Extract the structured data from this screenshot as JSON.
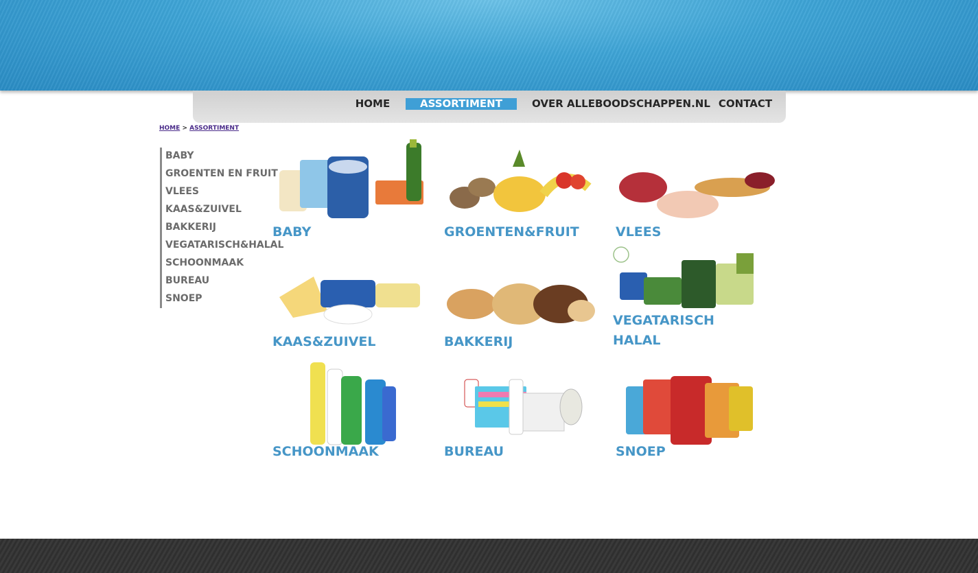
{
  "nav": {
    "home": "HOME",
    "assortiment": "ASSORTIMENT",
    "over": "OVER ALLEBOODSCHAPPEN.NL",
    "contact": "CONTACT"
  },
  "breadcrumb": {
    "home": "HOME",
    "separator": ">",
    "current": "ASSORTIMENT"
  },
  "sidebar": {
    "items": [
      {
        "label": "BABY"
      },
      {
        "label": "GROENTEN EN FRUIT"
      },
      {
        "label": "VLEES"
      },
      {
        "label": "KAAS&ZUIVEL"
      },
      {
        "label": "BAKKERIJ"
      },
      {
        "label": "VEGATARISCH&HALAL"
      },
      {
        "label": "SCHOONMAAK"
      },
      {
        "label": "BUREAU"
      },
      {
        "label": "SNOEP"
      }
    ]
  },
  "categories": {
    "baby": {
      "label": "BABY"
    },
    "groenten": {
      "label": "GROENTEN&FRUIT"
    },
    "vlees": {
      "label": "VLEES"
    },
    "kaas": {
      "label": "KAAS&ZUIVEL"
    },
    "bakkerij": {
      "label": "BAKKERIJ"
    },
    "vega_line1": {
      "label": "VEGATARISCH"
    },
    "vega_line2": {
      "label": "HALAL"
    },
    "schoonmaak": {
      "label": "SCHOONMAAK"
    },
    "bureau": {
      "label": "BUREAU"
    },
    "snoep": {
      "label": "SNOEP"
    }
  },
  "colors": {
    "accent": "#3f9fd6",
    "category_text": "#4696c7",
    "sidebar_text": "#6b6b6b",
    "footer": "#333333"
  }
}
